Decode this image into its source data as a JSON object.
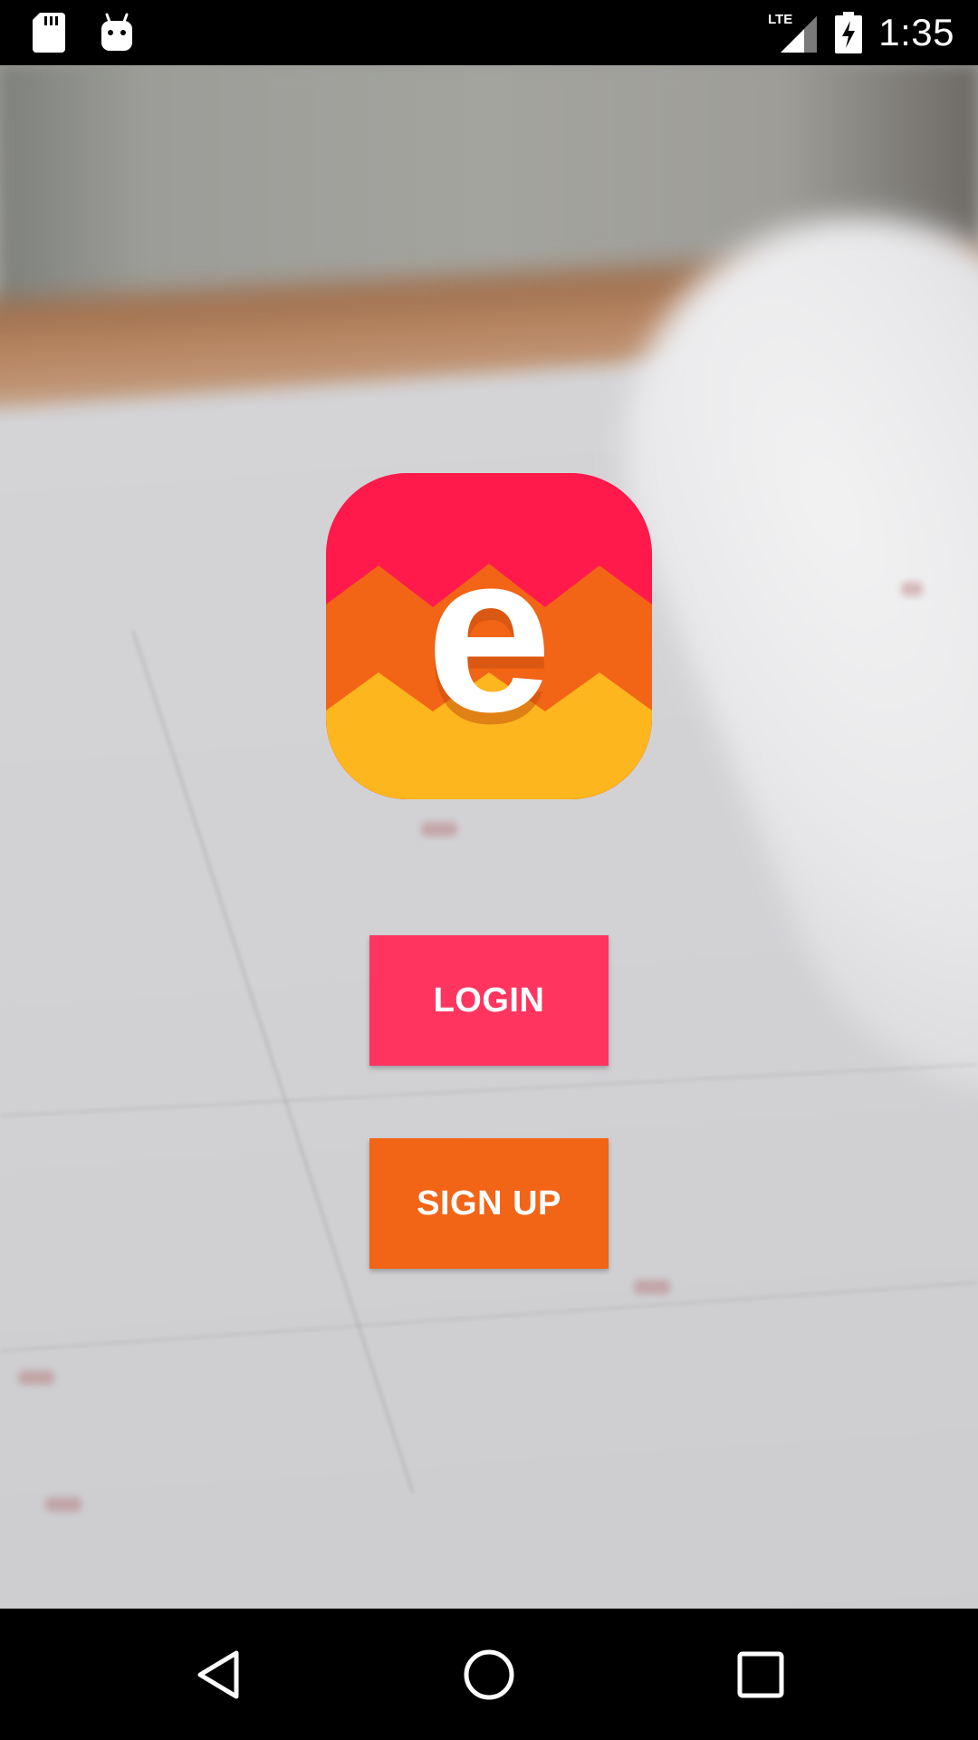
{
  "status_bar": {
    "time": "1:35",
    "network_label": "LTE",
    "icons": [
      "sd-card-icon",
      "android-icon",
      "signal-icon",
      "battery-charging-icon"
    ]
  },
  "logo": {
    "letter": "e",
    "colors": {
      "top": "#ff1a4b",
      "middle": "#f26416",
      "bottom": "#fdb61e",
      "letter": "#ffffff"
    }
  },
  "buttons": {
    "login_label": "LOGIN",
    "signup_label": "SIGN UP",
    "login_color": "#ff3560",
    "signup_color": "#f26416"
  },
  "nav_bar": {
    "icons": [
      "back-icon",
      "home-icon",
      "recents-icon"
    ]
  }
}
